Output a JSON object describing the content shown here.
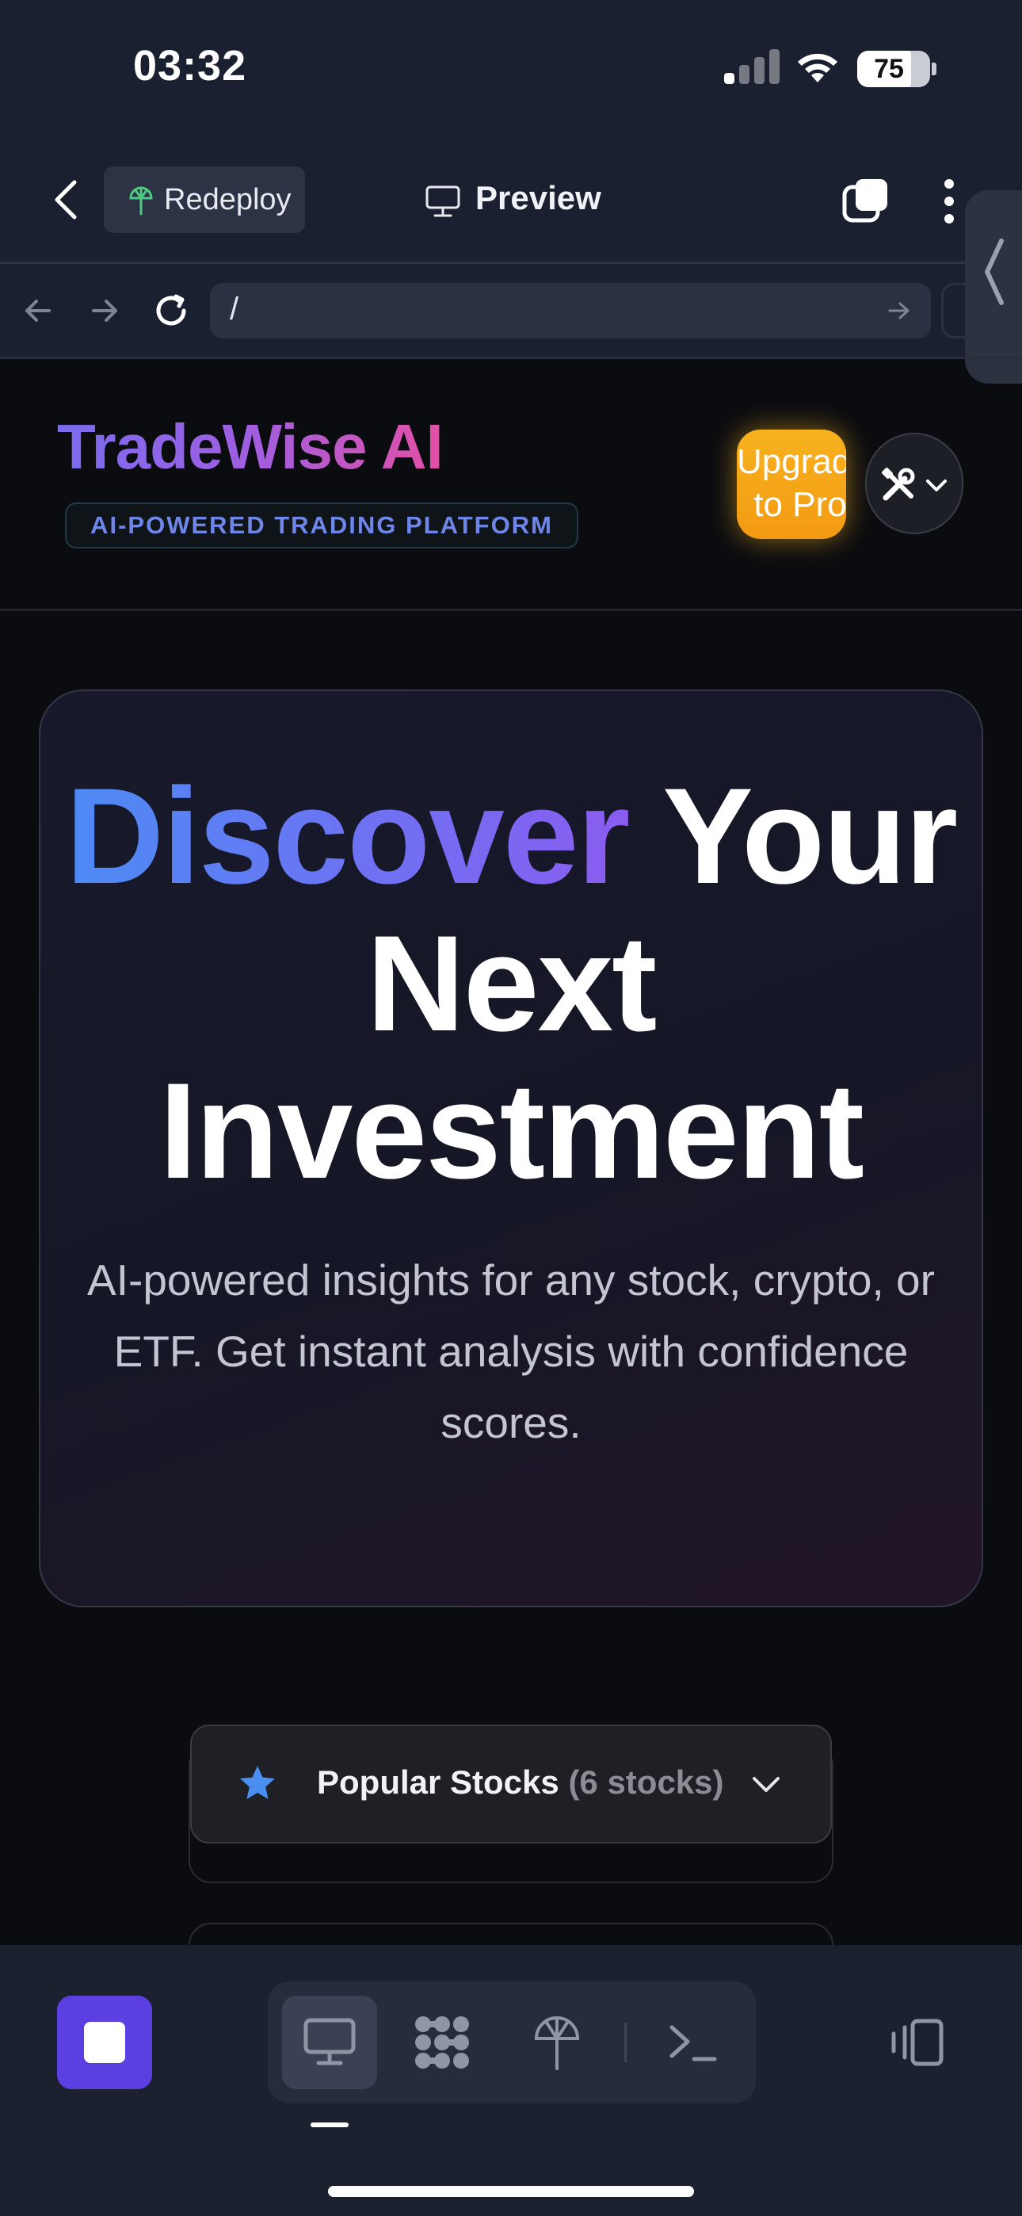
{
  "status_bar": {
    "time": "03:32",
    "battery": "75"
  },
  "browser": {
    "redeploy_label": "Redeploy",
    "preview_label": "Preview",
    "url": "/"
  },
  "header": {
    "logo": "TradeWise AI",
    "tagline": "AI-POWERED TRADING PLATFORM",
    "upgrade_label": "Upgrade to Pro"
  },
  "hero": {
    "title_accent": "Discover",
    "title_rest": " Your Next Investment",
    "subtitle": "AI-powered insights for any stock, crypto, or ETF. Get instant analysis with confidence scores."
  },
  "stocks": {
    "title": "Popular Stocks",
    "count": "(6 stocks)"
  },
  "colors": {
    "accent_purple": "#5b3fe0",
    "upgrade_orange": "#f7b21e",
    "brand_gradient_start": "#7a6cf0",
    "brand_gradient_end": "#e44fa6"
  },
  "icons": {
    "browser": [
      "back-chevron-icon",
      "globe-tree-icon",
      "monitor-icon",
      "tabs-icon",
      "more-vertical-icon",
      "arrow-left-icon",
      "arrow-right-icon",
      "reload-icon",
      "go-arrow-icon"
    ],
    "toolbar": [
      "stop-icon",
      "monitor-icon",
      "grid-blob-icon",
      "globe-tree-icon",
      "terminal-icon",
      "device-rotate-icon"
    ]
  }
}
